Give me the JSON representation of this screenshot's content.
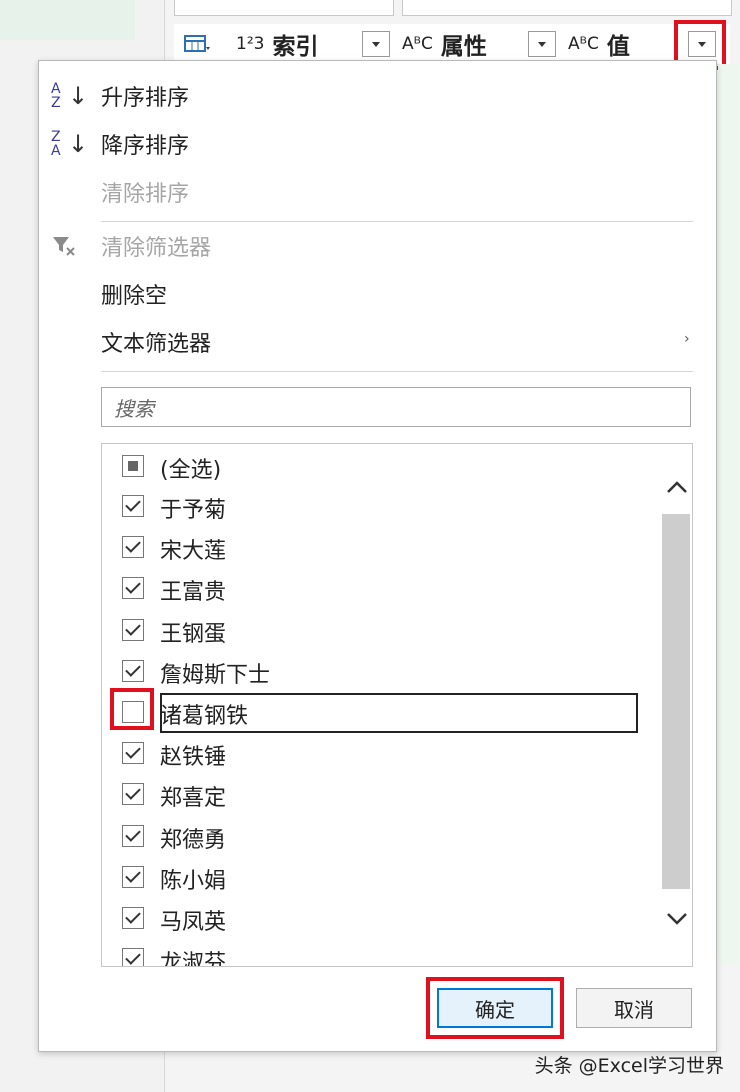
{
  "column_headers": [
    {
      "type_icon": "1²3",
      "label": "索引"
    },
    {
      "type_icon": "AᴮC",
      "label": "属性"
    },
    {
      "type_icon": "AᴮC",
      "label": "值"
    }
  ],
  "menu": {
    "sort_asc": "升序排序",
    "sort_desc": "降序排序",
    "clear_sort": "清除排序",
    "clear_filter": "清除筛选器",
    "remove_empty": "删除空",
    "text_filters": "文本筛选器"
  },
  "search": {
    "placeholder": "搜索"
  },
  "list": {
    "select_all": "(全选)",
    "items": [
      {
        "label": "于予菊",
        "checked": true
      },
      {
        "label": "宋大莲",
        "checked": true
      },
      {
        "label": "王富贵",
        "checked": true
      },
      {
        "label": "王钢蛋",
        "checked": true
      },
      {
        "label": "詹姆斯下士",
        "checked": true
      },
      {
        "label": "诸葛钢铁",
        "checked": false
      },
      {
        "label": "赵铁锤",
        "checked": true
      },
      {
        "label": "郑喜定",
        "checked": true
      },
      {
        "label": "郑德勇",
        "checked": true
      },
      {
        "label": "陈小娟",
        "checked": true
      },
      {
        "label": "马凤英",
        "checked": true
      },
      {
        "label": "龙淑芬",
        "checked": true
      }
    ]
  },
  "buttons": {
    "ok": "确定",
    "cancel": "取消"
  },
  "watermark": "头条 @Excel学习世界",
  "colors": {
    "highlight_red": "#e0101e",
    "primary_blue": "#0078d7"
  }
}
